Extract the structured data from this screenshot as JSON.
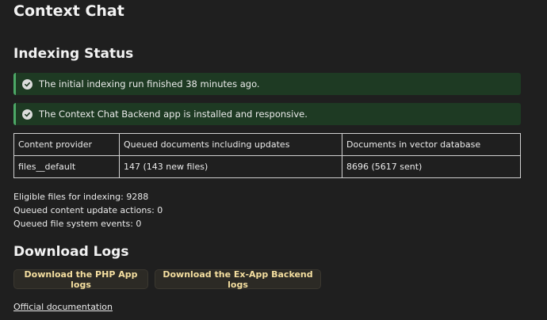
{
  "app_title": "Context Chat",
  "indexing": {
    "title": "Indexing Status",
    "notes": [
      "The initial indexing run finished 38 minutes ago.",
      "The Context Chat Backend app is installed and responsive."
    ],
    "table": {
      "headers": [
        "Content provider",
        "Queued documents including updates",
        "Documents in vector database"
      ],
      "rows": [
        [
          "files__default",
          "147 (143 new files)",
          "8696 (5617 sent)"
        ]
      ]
    },
    "stats": [
      "Eligible files for indexing: 9288",
      "Queued content update actions: 0",
      "Queued file system events: 0"
    ]
  },
  "logs": {
    "title": "Download Logs",
    "php_button": "Download the PHP App logs",
    "backend_button": "Download the Ex-App Backend logs"
  },
  "docs_link": "Official documentation",
  "colors": {
    "background": "#1f1f1f",
    "success_note_bg": "#1e3a23",
    "success_accent": "#4ca866",
    "button_text": "#f5dfa0"
  }
}
